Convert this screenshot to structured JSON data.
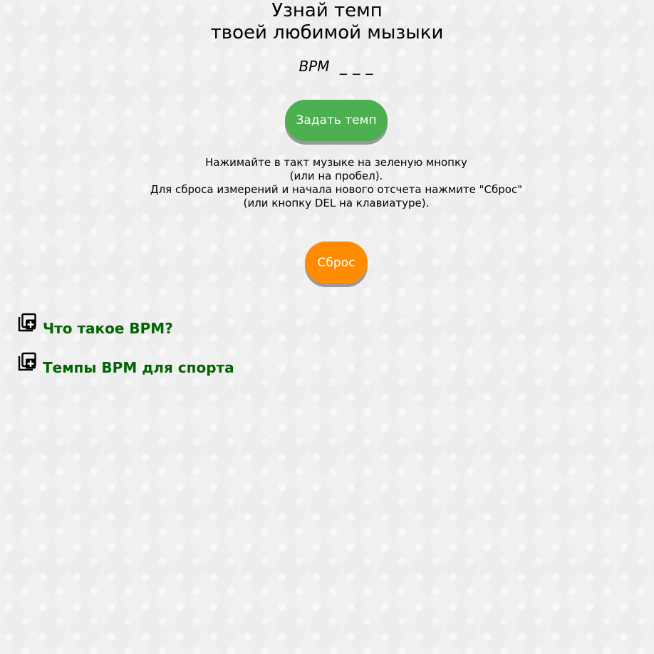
{
  "title": {
    "line1": "Узнай темп",
    "line2": "твоей любимой мызыки"
  },
  "bpm": {
    "label": "BPM",
    "value": "_ _ _"
  },
  "buttons": {
    "set_tempo": "Задать темп",
    "reset": "Сброс"
  },
  "instructions": [
    "Нажимайте в такт музыке на зеленую мнопку",
    "(или на пробел).",
    "Для сброса измерений и начала нового отсчета нажмите \"Сброс\"",
    "(или кнопку DEL на клавиатуре)."
  ],
  "links": [
    {
      "label": "Что такое BPM?",
      "icon": "add-to-library-icon"
    },
    {
      "label": "Темпы BPM для спорта",
      "icon": "add-to-library-icon"
    }
  ],
  "colors": {
    "set_tempo_button": "#4caf50",
    "reset_button": "#ff8c00",
    "link_text": "#006400"
  }
}
